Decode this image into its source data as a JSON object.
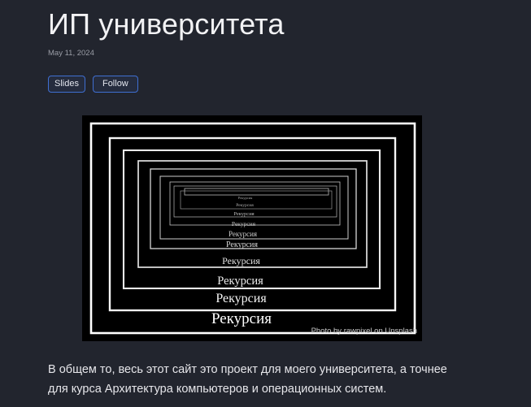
{
  "post": {
    "title": "ИП университета",
    "date": "May 11, 2024",
    "tags": [
      "Slides",
      "Follow"
    ],
    "image": {
      "frame_label": "Рекурсия",
      "credit": "Photo by rawpixel on Unsplash"
    },
    "paragraph_lines": [
      "В общем то, весь этот сайт это проект для моего университета, а точнее",
      "для курса Архитектура компьютеров и операционных систем."
    ]
  },
  "colors": {
    "background": "#22252e",
    "tag_border": "#3f6fd2",
    "text": "#e6e6ea",
    "muted": "#9a9da6"
  }
}
